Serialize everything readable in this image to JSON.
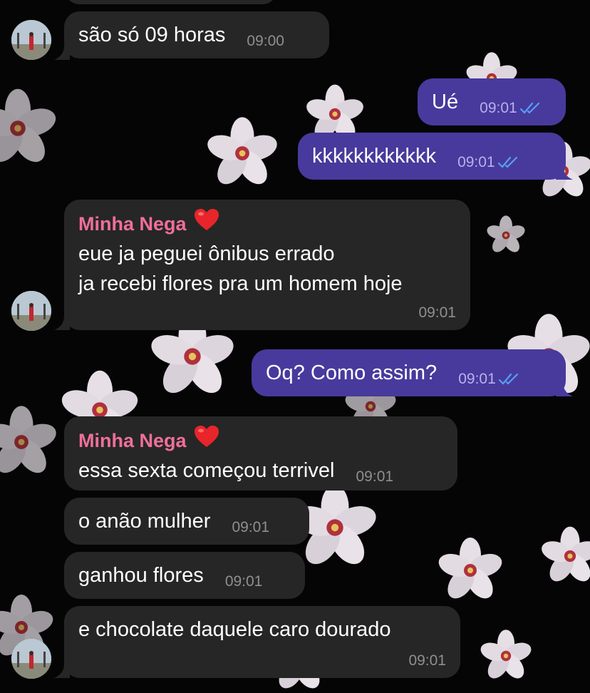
{
  "colors": {
    "incoming_bubble": "#262626",
    "outgoing_bubble": "#473a9c",
    "sender_name": "#f06f9a",
    "read_ticks": "#5b9cf5"
  },
  "messages": [
    {
      "text": "são só 09 horas",
      "time": "09:00"
    },
    {
      "text": "Ué",
      "time": "09:01"
    },
    {
      "text": "kkkkkkkkkkkk",
      "time": "09:01"
    },
    {
      "sender": "Minha Nega",
      "sender_emoji": "heart",
      "line1": "eue ja peguei ônibus errado",
      "line2": "ja recebi flores pra um homem hoje",
      "time": "09:01"
    },
    {
      "text": "Oq? Como assim?",
      "time": "09:01"
    },
    {
      "sender": "Minha Nega",
      "sender_emoji": "heart",
      "text": "essa sexta começou terrivel",
      "time": "09:01"
    },
    {
      "text": "o anão mulher",
      "time": "09:01"
    },
    {
      "text": "ganhou flores",
      "time": "09:01"
    },
    {
      "text": "e chocolate daquele caro dourado",
      "time": "09:01"
    }
  ],
  "icons": {
    "read_receipt": "double-check-icon",
    "sender_badge": "heart-icon",
    "avatar": "contact-avatar"
  }
}
